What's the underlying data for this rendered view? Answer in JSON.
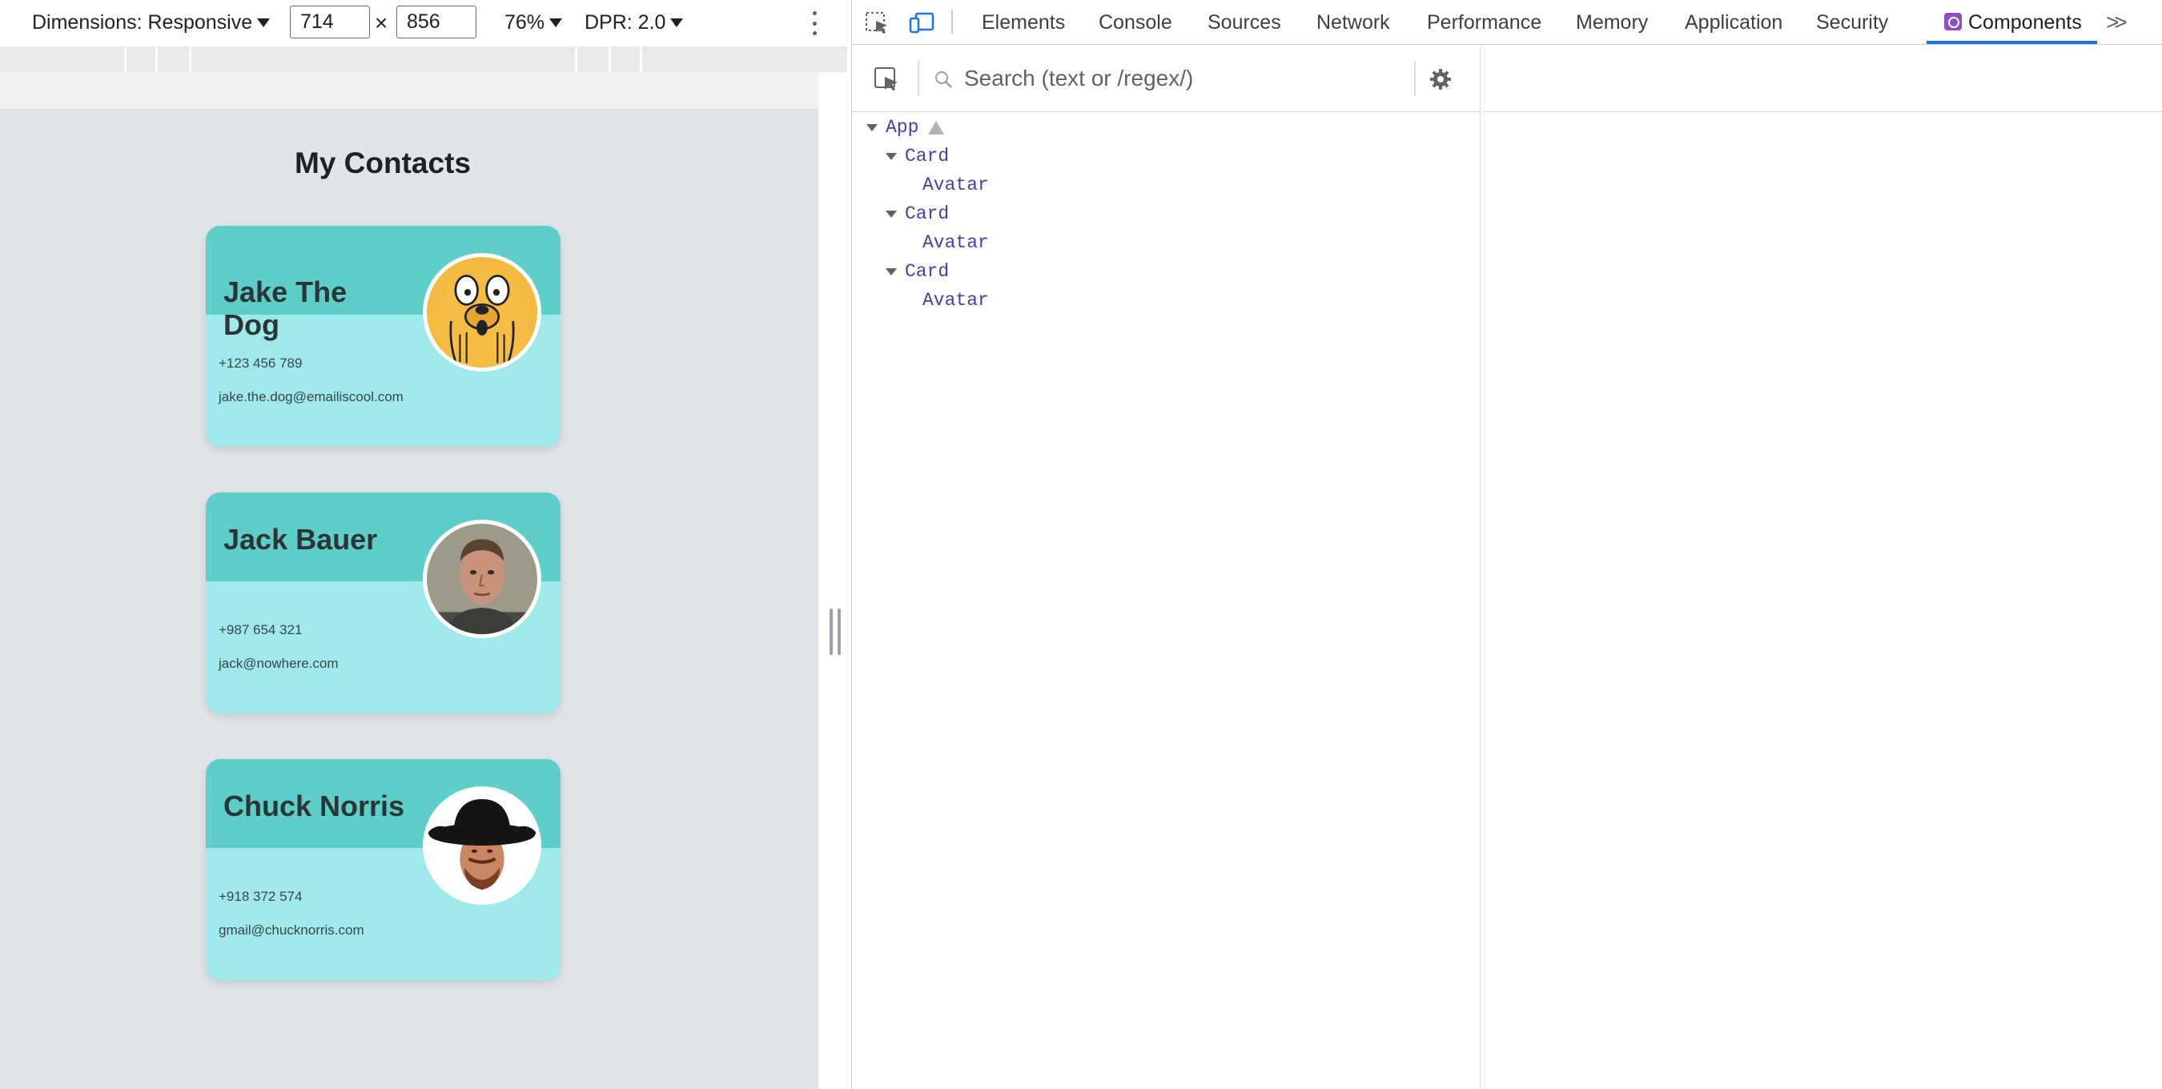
{
  "device_toolbar": {
    "dimensions_label": "Dimensions: Responsive",
    "width_value": "714",
    "height_value": "856",
    "times_symbol": "×",
    "zoom_label": "76%",
    "dpr_label": "DPR: 2.0"
  },
  "page": {
    "heading": "My Contacts",
    "contacts": [
      {
        "name": "Jake The Dog",
        "phone": "+123 456 789",
        "email": "jake.the.dog@emailiscool.com",
        "avatar_icon": "jake-the-dog-avatar"
      },
      {
        "name": "Jack Bauer",
        "phone": "+987 654 321",
        "email": "jack@nowhere.com",
        "avatar_icon": "jack-bauer-avatar"
      },
      {
        "name": "Chuck Norris",
        "phone": "+918 372 574",
        "email": "gmail@chucknorris.com",
        "avatar_icon": "chuck-norris-avatar"
      }
    ]
  },
  "devtools": {
    "tabs": [
      "Elements",
      "Console",
      "Sources",
      "Network",
      "Performance",
      "Memory",
      "Application",
      "Security",
      "Components"
    ],
    "active_tab": "Components",
    "overflow_label": ">>",
    "search_placeholder": "Search (text or /regex/)",
    "tree": [
      {
        "label": "App",
        "expandable": true,
        "warning": true
      },
      {
        "label": "Card",
        "expandable": true
      },
      {
        "label": "Avatar",
        "expandable": false
      },
      {
        "label": "Card",
        "expandable": true
      },
      {
        "label": "Avatar",
        "expandable": false
      },
      {
        "label": "Card",
        "expandable": true
      },
      {
        "label": "Avatar",
        "expandable": false
      }
    ]
  },
  "colors": {
    "card_header": "#5ecec9",
    "card_body": "#9fe9ea",
    "viewport_bg": "#e1e4e8",
    "tree_text": "#4b3bb0",
    "active_tab_underline": "#1a73e8"
  }
}
